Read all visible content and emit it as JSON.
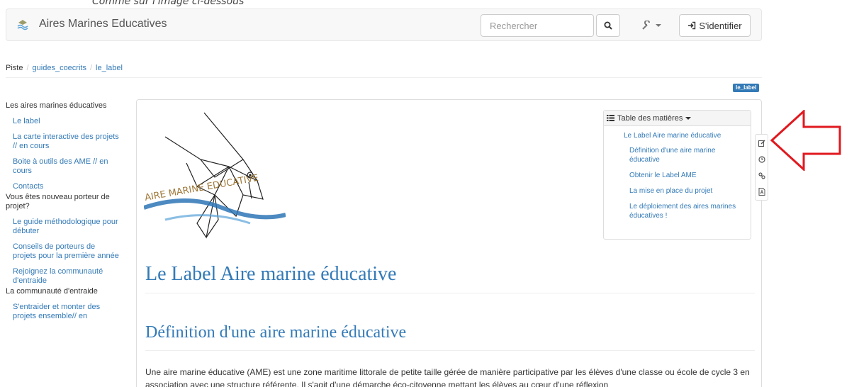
{
  "caption": "Comme sur l'image ci-dessous",
  "navbar": {
    "site_title": "Aires Marines Educatives",
    "search_placeholder": "Rechercher",
    "login_label": "S'identifier"
  },
  "breadcrumb": [
    "Piste",
    "guides_coecrits",
    "le_label"
  ],
  "tag_badge": "le_label",
  "sidebar": {
    "sections": [
      {
        "title": "Les aires marines éducatives",
        "items": [
          "Le label",
          "La carte interactive des projets // en cours",
          "Boite à outils des AME // en cours",
          "Contacts"
        ]
      },
      {
        "title": "Vous êtes nouveau porteur de projet?",
        "items": [
          "Le guide méthodologique pour débuter",
          "Conseils de porteurs de projets pour la première année",
          "Rejoignez la communauté d'entraide"
        ]
      },
      {
        "title": "La communauté d'entraide",
        "items": [
          "S'entraider et monter des projets ensemble// en"
        ]
      }
    ]
  },
  "logo_text": "AIRE MARINE EDUCATIVE",
  "toc": {
    "title": "Table des matières",
    "items": [
      {
        "label": "Le Label Aire marine éducative",
        "level": 1
      },
      {
        "label": "Définition d'une aire marine éducative",
        "level": 2
      },
      {
        "label": "Obtenir le Label AME",
        "level": 2
      },
      {
        "label": "La mise en place du projet",
        "level": 2
      },
      {
        "label": "Le déploiement des aires marines éducatives !",
        "level": 2
      }
    ]
  },
  "content": {
    "title": "Le Label Aire marine éducative",
    "section_title": "Définition d'une aire marine éducative",
    "paragraph": "Une aire marine éducative (AME) est une zone maritime littorale de petite taille gérée de manière participative par les élèves d'une classe ou école de cycle 3 en association avec une structure référente. Il s'agit d'une démarche éco-citoyenne mettant les élèves au cœur d'une réflexion"
  },
  "colors": {
    "link": "#337ab7",
    "navbar_bg": "#f8f8f8",
    "arrow": "#e0191f",
    "logo_blue": "#2e75b6",
    "logo_brown": "#a07a3c"
  },
  "side_tools": [
    "edit-icon",
    "history-icon",
    "link-icon",
    "pdf-icon"
  ]
}
